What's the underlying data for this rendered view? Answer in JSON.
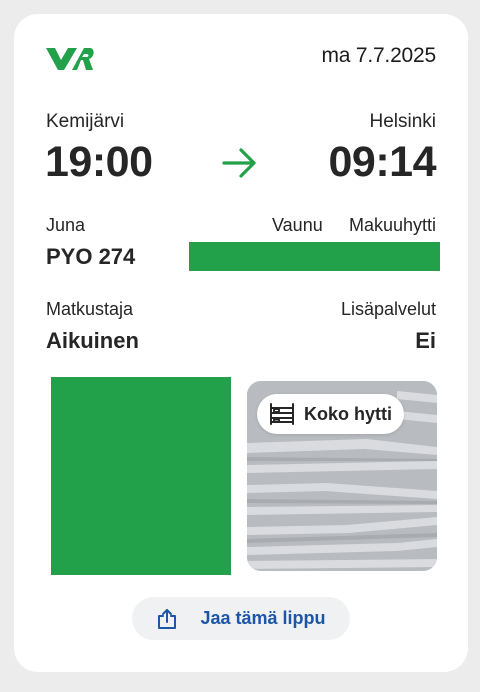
{
  "ticket": {
    "brand": "VR",
    "date": "ma 7.7.2025",
    "departure": {
      "station": "Kemijärvi",
      "time": "19:00"
    },
    "arrival": {
      "station": "Helsinki",
      "time": "09:14"
    },
    "train": {
      "label": "Juna",
      "value": "PYO 274"
    },
    "car": {
      "label": "Vaunu"
    },
    "cabin": {
      "label": "Makuuhytti"
    },
    "passenger": {
      "label": "Matkustaja",
      "value": "Aikuinen"
    },
    "extras": {
      "label": "Lisäpalvelut",
      "value": "Ei"
    },
    "cabin_badge": {
      "label": "Koko hytti",
      "icon": "bunk-bed-icon"
    },
    "share": {
      "label": "Jaa tämä lippu",
      "icon": "share-icon"
    }
  },
  "colors": {
    "brand_green": "#22a14a",
    "link_blue": "#1d56a6"
  }
}
